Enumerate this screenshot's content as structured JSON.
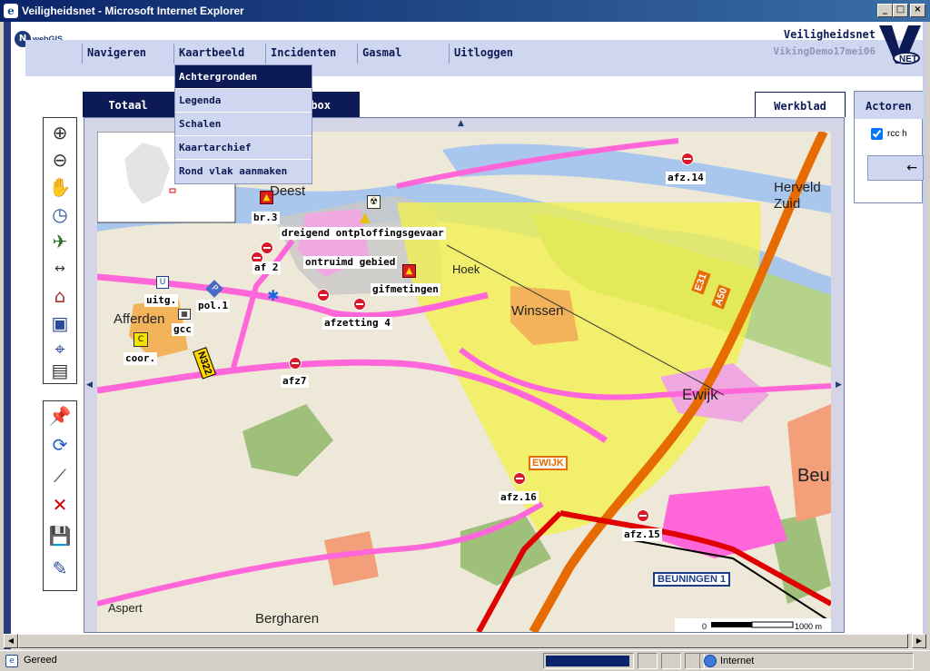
{
  "window": {
    "title": "Veiligheidsnet - Microsoft Internet Explorer"
  },
  "header": {
    "logo_text": "webGIS",
    "app_title": "Veiligheidsnet",
    "session": "VikingDemo17mei06",
    "brand": "NET"
  },
  "menu": {
    "items": [
      "Navigeren",
      "Kaartbeeld",
      "Incidenten",
      "Gasmal",
      "Uitloggen"
    ]
  },
  "dropdown": {
    "items": [
      "Achtergronden",
      "Legenda",
      "Schalen",
      "Kaartarchief",
      "Rond vlak aanmaken"
    ],
    "selected": "Achtergronden"
  },
  "tabs": {
    "left": [
      "Totaal",
      "box"
    ],
    "right": "Werkblad"
  },
  "actoren": {
    "title": "Actoren",
    "checkbox_label": "rcc h",
    "checked": true
  },
  "map": {
    "incident_labels": [
      "dreigend ontploffingsgevaar",
      "ontruimd gebied",
      "gifmetingen",
      "br.3",
      "af 2",
      "afzetting 4",
      "uitg.",
      "pol.1",
      "gcc",
      "coor.",
      "afz7",
      "afz.16",
      "afz.15",
      "afz.14"
    ],
    "towns": [
      "Deest",
      "Afferden",
      "Hoek",
      "Winssen",
      "Ewijk",
      "Herveld Zuid",
      "Beu",
      "Aspert",
      "Bergharen"
    ],
    "road_signs": [
      "N322",
      "E31",
      "A50",
      "EWIJK",
      "BEUNINGEN 1"
    ],
    "scale_start": "0",
    "scale_end": "1000 m"
  },
  "status": {
    "left": "Gereed",
    "zone": "Internet"
  },
  "colors": {
    "navy": "#0c1a55",
    "menu_bg": "#cfd6ef",
    "danger_zone": "#f3f24a",
    "road_pink": "#ff66d9"
  }
}
